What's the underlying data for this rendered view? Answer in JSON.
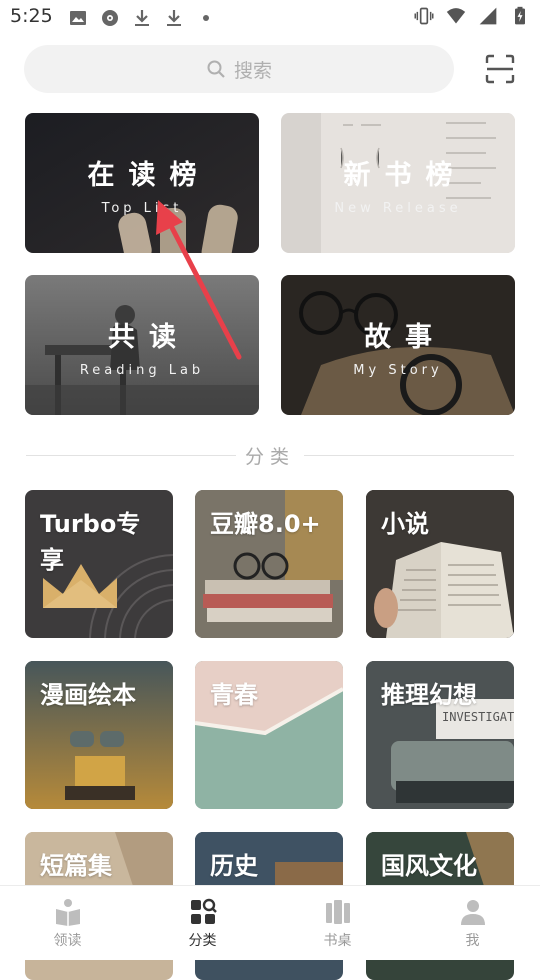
{
  "status_bar": {
    "time": "5:25",
    "left_icons": [
      "image-icon",
      "disc-icon",
      "download-icon",
      "download-icon",
      "dot-icon"
    ],
    "right_icons": [
      "vibrate-icon",
      "wifi-icon",
      "signal-icon",
      "battery-icon"
    ]
  },
  "search": {
    "placeholder": "搜索"
  },
  "rank_cards": [
    {
      "title": "在读榜",
      "subtitle": "Top List"
    },
    {
      "title": "新书榜",
      "subtitle": "New Release"
    },
    {
      "title": "共读",
      "subtitle": "Reading Lab"
    },
    {
      "title": "故事",
      "subtitle": "My Story"
    }
  ],
  "section_title": "分类",
  "categories": [
    {
      "label": "Turbo专享"
    },
    {
      "label": "豆瓣8.0+"
    },
    {
      "label": "小说"
    },
    {
      "label": "漫画绘本"
    },
    {
      "label": "青春"
    },
    {
      "label": "推理幻想"
    },
    {
      "label": "短篇集"
    },
    {
      "label": "历史"
    },
    {
      "label": "国风文化"
    }
  ],
  "tabs": [
    {
      "label": "领读",
      "icon": "book-open-icon",
      "active": false
    },
    {
      "label": "分类",
      "icon": "category-grid-icon",
      "active": true
    },
    {
      "label": "书桌",
      "icon": "bookshelf-icon",
      "active": false
    },
    {
      "label": "我",
      "icon": "person-icon",
      "active": false
    }
  ],
  "colors": {
    "accent_arrow": "#e8404a",
    "tab_active": "#333333",
    "tab_inactive": "#9a9a9a"
  }
}
